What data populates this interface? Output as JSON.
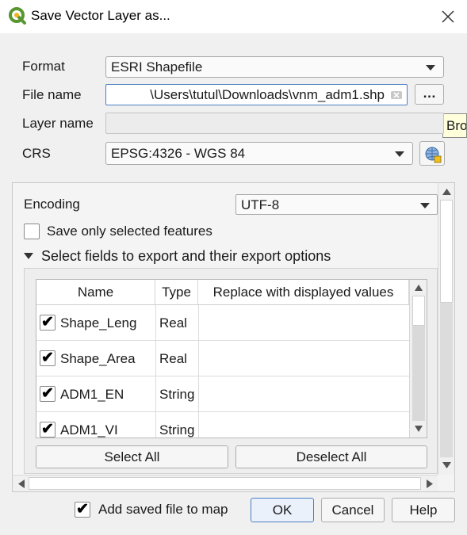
{
  "window": {
    "title": "Save Vector Layer as...",
    "app_icon": "qgis-logo-icon",
    "close_icon": "close-icon"
  },
  "form": {
    "format_label": "Format",
    "format_value": "ESRI Shapefile",
    "file_name_label": "File name",
    "file_name_value": "\\Users\\tutul\\Downloads\\vnm_adm1.shp",
    "browse_button": "…",
    "browse_tooltip": "Bro",
    "layer_name_label": "Layer name",
    "layer_name_value": "",
    "crs_label": "CRS",
    "crs_value": "EPSG:4326 - WGS 84"
  },
  "options": {
    "encoding_label": "Encoding",
    "encoding_value": "UTF-8",
    "save_selected_label": "Save only selected features",
    "save_selected_checked": false,
    "fields_section_label": "Select fields to export and their export options"
  },
  "fields_table": {
    "headers": [
      "Name",
      "Type",
      "Replace with displayed values"
    ],
    "rows": [
      {
        "checked": true,
        "name": "Shape_Leng",
        "type": "Real",
        "replace": ""
      },
      {
        "checked": true,
        "name": "Shape_Area",
        "type": "Real",
        "replace": ""
      },
      {
        "checked": true,
        "name": "ADM1_EN",
        "type": "String",
        "replace": ""
      },
      {
        "checked": true,
        "name": "ADM1_VI",
        "type": "String",
        "replace": ""
      }
    ]
  },
  "table_buttons": {
    "select_all": "Select All",
    "deselect_all": "Deselect All"
  },
  "footer": {
    "add_to_map_label": "Add saved file to map",
    "add_to_map_checked": true,
    "ok": "OK",
    "cancel": "Cancel",
    "help": "Help"
  },
  "colors": {
    "accent_blue": "#4a7fc1",
    "qgis_green": "#589632"
  }
}
